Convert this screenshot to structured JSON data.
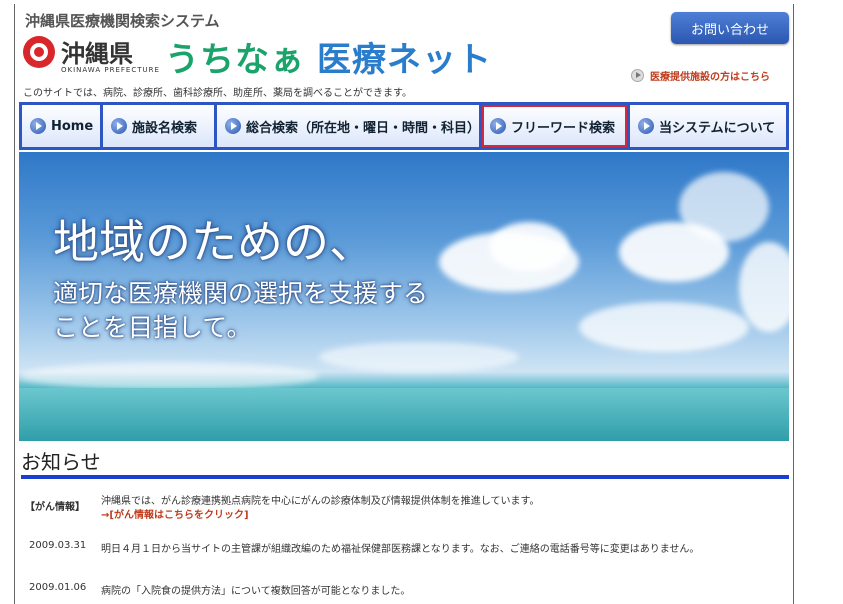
{
  "header": {
    "system_title": "沖縄県医療機関検索システム",
    "logo_text": "沖縄県",
    "logo_sub": "OKINAWA PREFECTURE",
    "brand_part1": "うちなぁ",
    "brand_part2": "医療ネット",
    "tagline": "このサイトでは、病院、診療所、歯科診療所、助産所、薬局を調べることができます。",
    "contact_button": "お問い合わせ",
    "provider_link": "医療提供施設の方はこちら"
  },
  "nav": {
    "items": [
      {
        "label": "Home",
        "active": false
      },
      {
        "label": "施設名検索",
        "active": false
      },
      {
        "label": "総合検索（所在地・曜日・時間・科目）",
        "active": false
      },
      {
        "label": "フリーワード検索",
        "active": true
      },
      {
        "label": "当システムについて",
        "active": false
      }
    ]
  },
  "hero": {
    "title": "地域のための、",
    "line1": "適切な医療機関の選択を支援する",
    "line2": "ことを目指して。"
  },
  "news": {
    "heading": "お知らせ",
    "items": [
      {
        "tag": "【がん情報】",
        "text": "沖縄県では、がん診療連携拠点病院を中心にがんの診療体制及び情報提供体制を推進しています。",
        "link": "→[がん情報はこちらをクリック]"
      },
      {
        "date": "2009.03.31",
        "text": "明日４月１日から当サイトの主管課が組織改編のため福祉保健部医務課となります。なお、ご連絡の電話番号等に変更はありません。"
      },
      {
        "date": "2009.01.06",
        "text": "病院の「入院食の提供方法」について複数回答が可能となりました。"
      }
    ]
  },
  "colors": {
    "nav_bg": "#2e55c4",
    "active_outline": "#d12a3d",
    "news_rule": "#1a3fd0",
    "link": "#c03d1e"
  }
}
